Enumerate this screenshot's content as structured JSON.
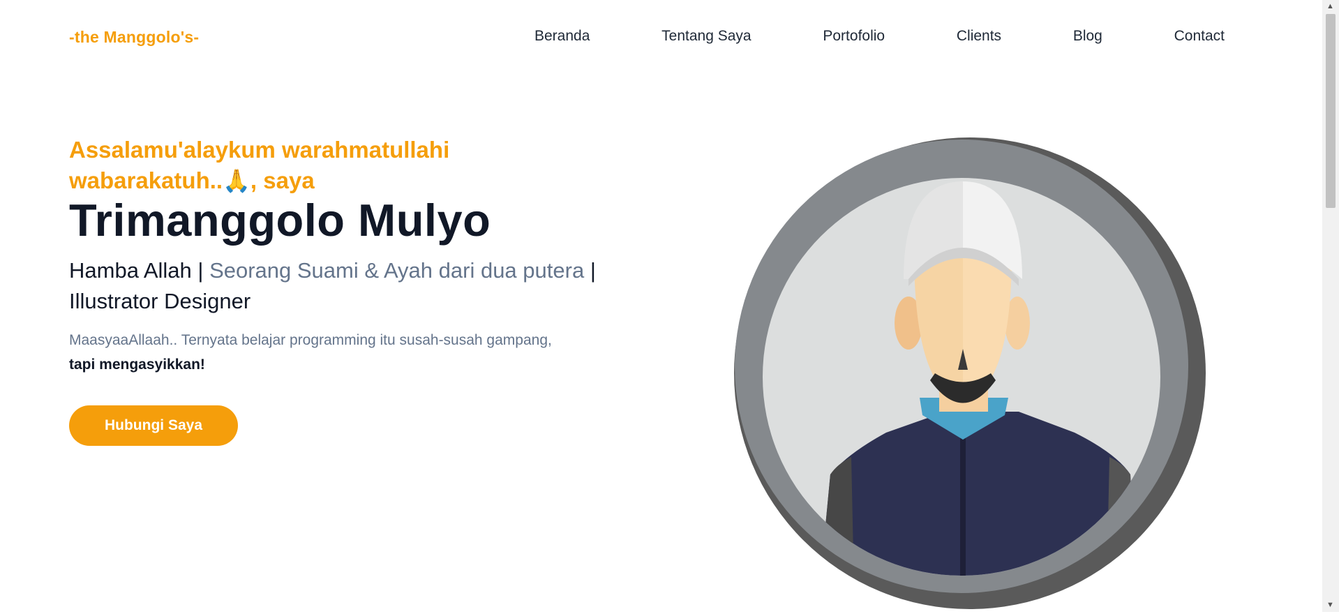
{
  "brand": "-the Manggolo's-",
  "nav": {
    "items": [
      "Beranda",
      "Tentang Saya",
      "Portofolio",
      "Clients",
      "Blog",
      "Contact"
    ]
  },
  "hero": {
    "greeting": "Assalamu'alaykum warahmatullahi wabarakatuh..",
    "greeting_emoji": "🙏",
    "greeting_suffix": ", saya",
    "name": "Trimanggolo Mulyo",
    "role_1": "Hamba Allah |",
    "role_2": "Seorang Suami & Ayah dari dua putera",
    "role_3": "| Illustrator Designer",
    "description": "MaasyaaAllaah.. Ternyata belajar programming itu susah-susah gampang,",
    "description_bold": "tapi mengasyikkan!",
    "cta_label": "Hubungi Saya"
  },
  "avatar": {
    "icon": "muslim-man-avatar-illustration"
  },
  "colors": {
    "accent": "#f59e0b",
    "heading": "#111827",
    "muted": "#64748b"
  }
}
